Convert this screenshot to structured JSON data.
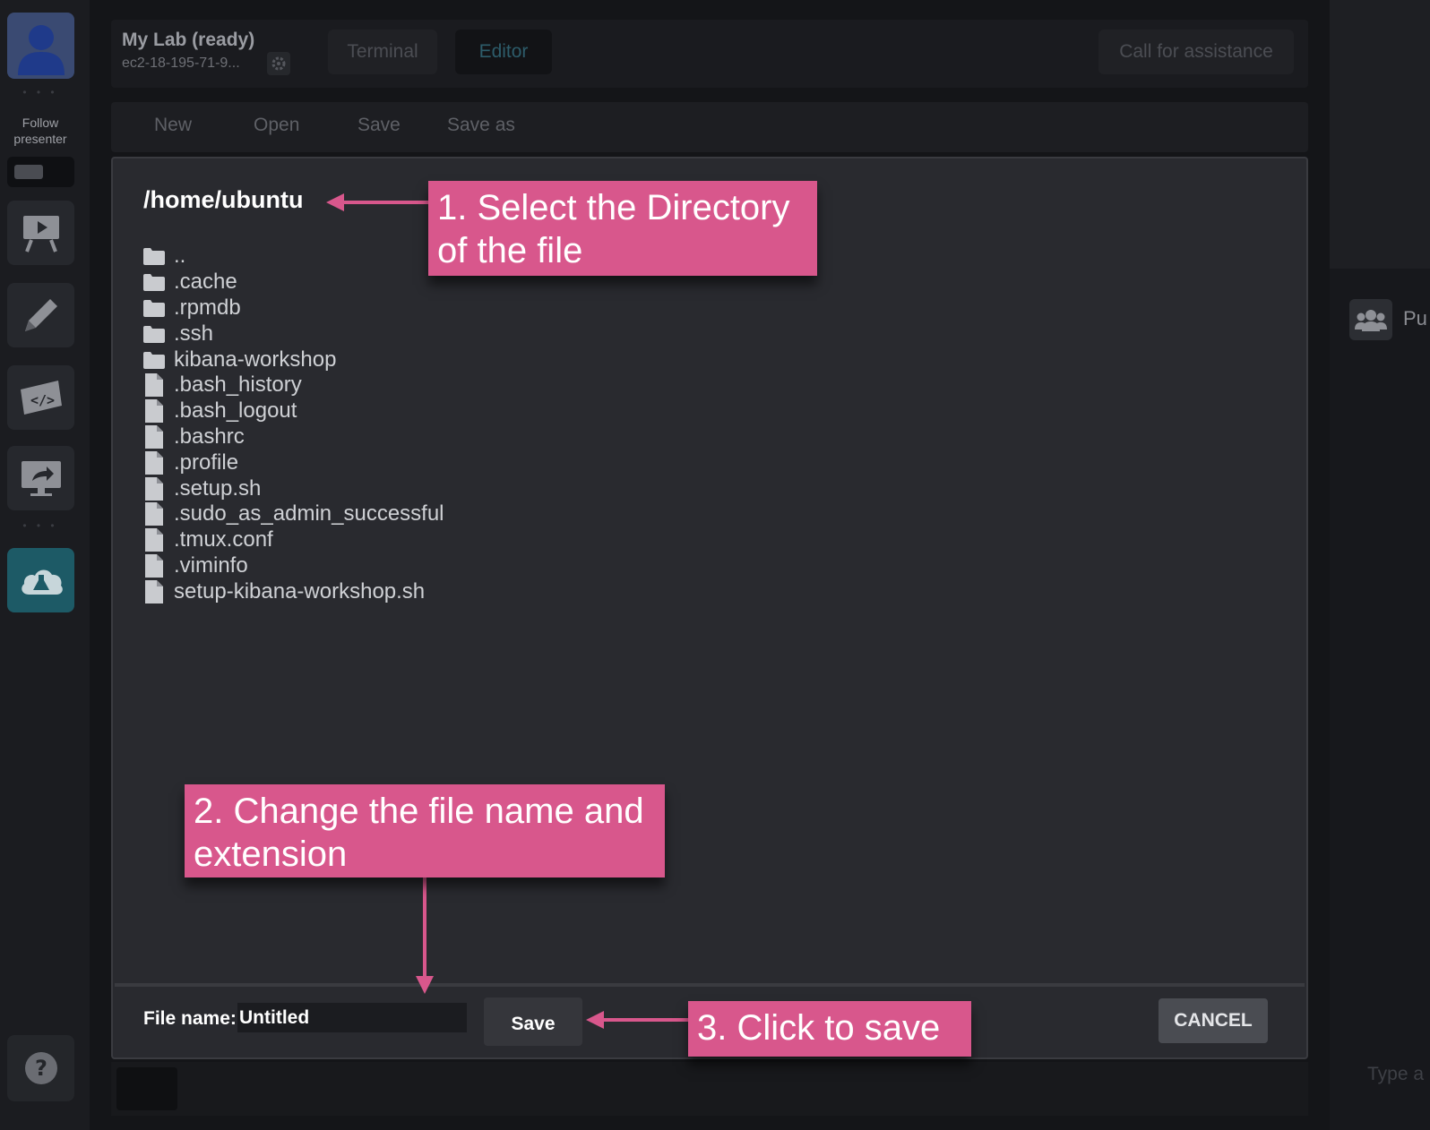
{
  "header": {
    "lab_title": "My Lab (ready)",
    "lab_host": "ec2-18-195-71-9...",
    "tabs": [
      {
        "label": "Terminal"
      },
      {
        "label": "Editor"
      }
    ],
    "assist_label": "Call for assistance"
  },
  "sidebar": {
    "follow_label": "Follow\npresenter",
    "items": [
      {
        "icon": "presentation-icon"
      },
      {
        "icon": "pencil-icon"
      },
      {
        "icon": "code-ticket-icon"
      },
      {
        "icon": "screen-share-icon"
      },
      {
        "icon": "cloud-lab-icon"
      }
    ],
    "help_icon": "help-icon"
  },
  "editor_menu": {
    "items": [
      "New",
      "Open",
      "Save",
      "Save as"
    ]
  },
  "dialog": {
    "path": "/home/ubuntu",
    "files": [
      {
        "name": "..",
        "type": "folder"
      },
      {
        "name": ".cache",
        "type": "folder"
      },
      {
        "name": ".rpmdb",
        "type": "folder"
      },
      {
        "name": ".ssh",
        "type": "folder"
      },
      {
        "name": "kibana-workshop",
        "type": "folder"
      },
      {
        "name": ".bash_history",
        "type": "file"
      },
      {
        "name": ".bash_logout",
        "type": "file"
      },
      {
        "name": ".bashrc",
        "type": "file"
      },
      {
        "name": ".profile",
        "type": "file"
      },
      {
        "name": ".setup.sh",
        "type": "file"
      },
      {
        "name": ".sudo_as_admin_successful",
        "type": "file"
      },
      {
        "name": ".tmux.conf",
        "type": "file"
      },
      {
        "name": ".viminfo",
        "type": "file"
      },
      {
        "name": "setup-kibana-workshop.sh",
        "type": "file"
      }
    ],
    "file_name_label": "File name:",
    "file_name_value": "Untitled",
    "save_label": "Save",
    "cancel_label": "CANCEL"
  },
  "right_panel": {
    "tab_label_partial": "Pu",
    "chat_placeholder_partial": "Type a"
  },
  "annotations": [
    {
      "text": "1. Select the Directory of the file"
    },
    {
      "text": "2. Change the file name and extension"
    },
    {
      "text": "3. Click to save"
    }
  ],
  "colors": {
    "callout": "#d8578c",
    "background": "#141518",
    "dialog": "#292a2f",
    "active_tab_text": "#2d5c6a"
  }
}
